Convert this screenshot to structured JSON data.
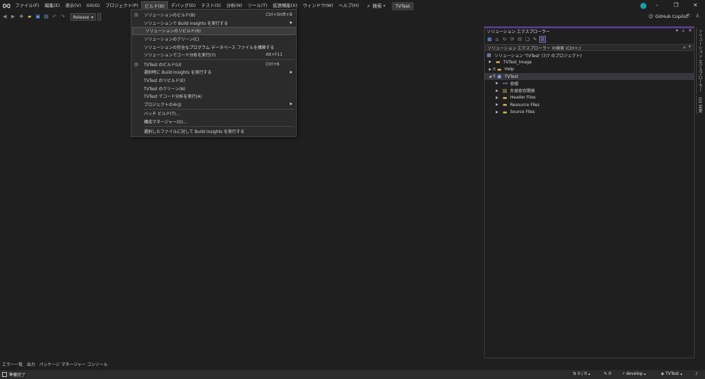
{
  "menu": {
    "items": [
      "ファイル(F)",
      "編集(E)",
      "表示(V)",
      "Git(G)",
      "プロジェクト(P)",
      "ビルド(B)",
      "デバッグ(D)",
      "テスト(S)",
      "分析(N)",
      "ツール(T)",
      "拡張機能(X)",
      "ウィンドウ(W)",
      "ヘルプ(H)"
    ],
    "active_index": 5,
    "search_label": "検索",
    "project_name": "TVTest"
  },
  "toolbar": {
    "configuration": "Release",
    "copilot_label": "GitHub Copilot"
  },
  "build_menu": {
    "groups": [
      [
        {
          "label": "ソリューションのビルド(B)",
          "shortcut": "Ctrl+Shift+B",
          "icon": "build-icon"
        },
        {
          "label": "ソリューションで Build Insights を実行する",
          "submenu": true
        },
        {
          "label": "ソリューションのリビルド(R)",
          "highlighted": true
        },
        {
          "label": "ソリューションのクリーン(C)"
        },
        {
          "label": "ソリューションの完全なプログラム データベース ファイルを構築する"
        },
        {
          "label": "ソリューションでコード分析を実行(Y)",
          "shortcut": "Alt+F11"
        }
      ],
      [
        {
          "label": "TVTest のビルド(U)",
          "shortcut": "Ctrl+B",
          "icon": "build-icon"
        },
        {
          "label": "選択時に Build Insights を実行する",
          "submenu": true
        },
        {
          "label": "TVTest のリビルド(E)"
        },
        {
          "label": "TVTest のクリーン(N)"
        },
        {
          "label": "TVTest でコード分析を実行(A)"
        },
        {
          "label": "プロジェクトのみ(J)",
          "submenu": true
        }
      ],
      [
        {
          "label": "バッチ ビルド(T)..."
        },
        {
          "label": "構成マネージャー(O)..."
        }
      ],
      [
        {
          "label": "選択したファイルに対して Build Insights を実行する"
        }
      ]
    ]
  },
  "solution_explorer": {
    "title": "ソリューション エクスプローラー",
    "search_placeholder": "ソリューション エクスプローラー の検索 (Ctrl+;)",
    "tree": [
      {
        "label": "ソリューション 'TVTest' (7/7 のプロジェクト)",
        "level": 0,
        "icon": "solution-icon",
        "expander": ""
      },
      {
        "label": "TVTest_Image",
        "level": 1,
        "icon": "folder-icon",
        "expander": "▶"
      },
      {
        "label": "Help",
        "level": 1,
        "icon": "folder-icon",
        "expander": "▶",
        "lock": true
      },
      {
        "label": "TVTest",
        "level": 1,
        "icon": "project-icon",
        "expander": "◢",
        "lock": true,
        "selected": true
      },
      {
        "label": "参照",
        "level": 2,
        "icon": "references-icon",
        "expander": "▶"
      },
      {
        "label": "外部依存関係",
        "level": 2,
        "icon": "dependencies-icon",
        "expander": "▶"
      },
      {
        "label": "Header Files",
        "level": 2,
        "icon": "folder-icon",
        "expander": "▶"
      },
      {
        "label": "Resource Files",
        "level": 2,
        "icon": "folder-icon",
        "expander": "▶"
      },
      {
        "label": "Source Files",
        "level": 2,
        "icon": "folder-icon",
        "expander": "▶"
      }
    ]
  },
  "right_tabs": [
    "ソリューション エクスプローラー",
    "Git 変更"
  ],
  "bottom_tabs": [
    "エラー一覧",
    "出力",
    "パッケージ マネージャー コンソール"
  ],
  "status": {
    "ready": "準備完了",
    "changes": "0 / 0",
    "pencil_count": "0",
    "branch": "develop",
    "repo": "TVTest"
  },
  "colors": {
    "accent": "#5b3aa6",
    "background": "#1f1f1f",
    "menu_bg": "#2b2b2b"
  }
}
